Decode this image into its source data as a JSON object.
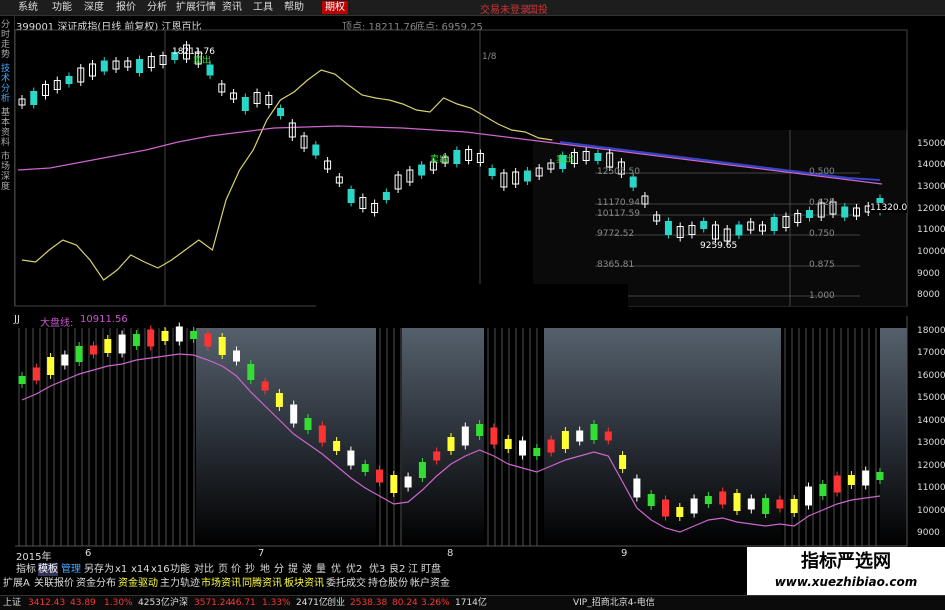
{
  "menu": {
    "items": [
      "系统",
      "功能",
      "深度",
      "报价",
      "分析",
      "扩展行情",
      "资讯",
      "工具",
      "帮助"
    ],
    "active": "期权",
    "right_items": [
      "交易未登录",
      "国投"
    ]
  },
  "left_tabs": [
    "分时走势",
    "技术分析",
    "基本资料",
    "市场深度"
  ],
  "header": {
    "code_name": "399001 深证成指(日线 前复权) 江恩百比",
    "high_point": "顶点: 18211.76",
    "low_point": "底点: 6959.25"
  },
  "top_chart": {
    "price_axis": [
      "15000",
      "14000",
      "13000",
      "12000",
      "11000",
      "10000",
      "9000",
      "8000"
    ],
    "fib_levels": [
      {
        "price": "12505.50",
        "ratio": "0.500"
      },
      {
        "price": "11170.94",
        "ratio": "0.625"
      },
      {
        "price": "10117.59",
        "ratio": "0.750"
      },
      {
        "price": "9772.52",
        "ratio": "0.750"
      },
      {
        "price": "8365.81",
        "ratio": "0.875"
      },
      {
        "price": "",
        "ratio": "1.000"
      }
    ],
    "annotations": {
      "peak": "18211.76",
      "trough": "9259.65",
      "last": "11320.0",
      "signal": "卖出",
      "marker": "1/8"
    }
  },
  "indicator": {
    "name": "JJ",
    "title": "大盘线:",
    "value": "10911.56",
    "axis": [
      "18000",
      "17000",
      "16000",
      "15000",
      "14000",
      "13000",
      "12000",
      "11000",
      "10000",
      "9000"
    ]
  },
  "time_axis": {
    "year": "2015年",
    "months": [
      "6",
      "7",
      "8",
      "9"
    ]
  },
  "toolbar": {
    "items": [
      "指标",
      "模板",
      "管理",
      "另存为",
      "x1",
      "x14",
      "x16",
      "功能",
      "对比",
      "页",
      "价",
      "抄",
      "地",
      "分",
      "提",
      "波",
      "量",
      "优",
      "优2",
      "优3",
      "良2",
      "江",
      "盯盘"
    ],
    "items2": [
      "扩展A",
      "关联报价",
      "资金分布",
      "资金驱动",
      "主力轨迹",
      "市场资讯",
      "同腾资讯",
      "板块资讯",
      "委托成交",
      "持仓股份",
      "帐户资金"
    ]
  },
  "status": {
    "sh_label": "上证",
    "sh_value": "3412.43",
    "sh_change": "43.89",
    "sh_pct": "1.30%",
    "sh_vol": "4253亿",
    "sz_label": "沪深",
    "sz_value": "3571.24",
    "sz_change": "46.71",
    "sz_pct": "1.33%",
    "sz_vol": "2471亿",
    "cy_label": "创业",
    "cy_value": "2538.38",
    "cy_change": "80.24",
    "cy_pct": "3.26%",
    "cy_vol": "1714亿",
    "broker": "VIP_招商北京4-电信"
  },
  "watermark": {
    "title": "指标严选网",
    "url": "www.xuezhibiao.com"
  },
  "colors": {
    "up": "#ffffff",
    "down": "#2bd6c8",
    "up_ind": "#ffff33",
    "down_ind": "#33dd33",
    "ma": "#cc66cc",
    "yellow_line": "#d8d070",
    "blue_ma": "#3344cc"
  }
}
